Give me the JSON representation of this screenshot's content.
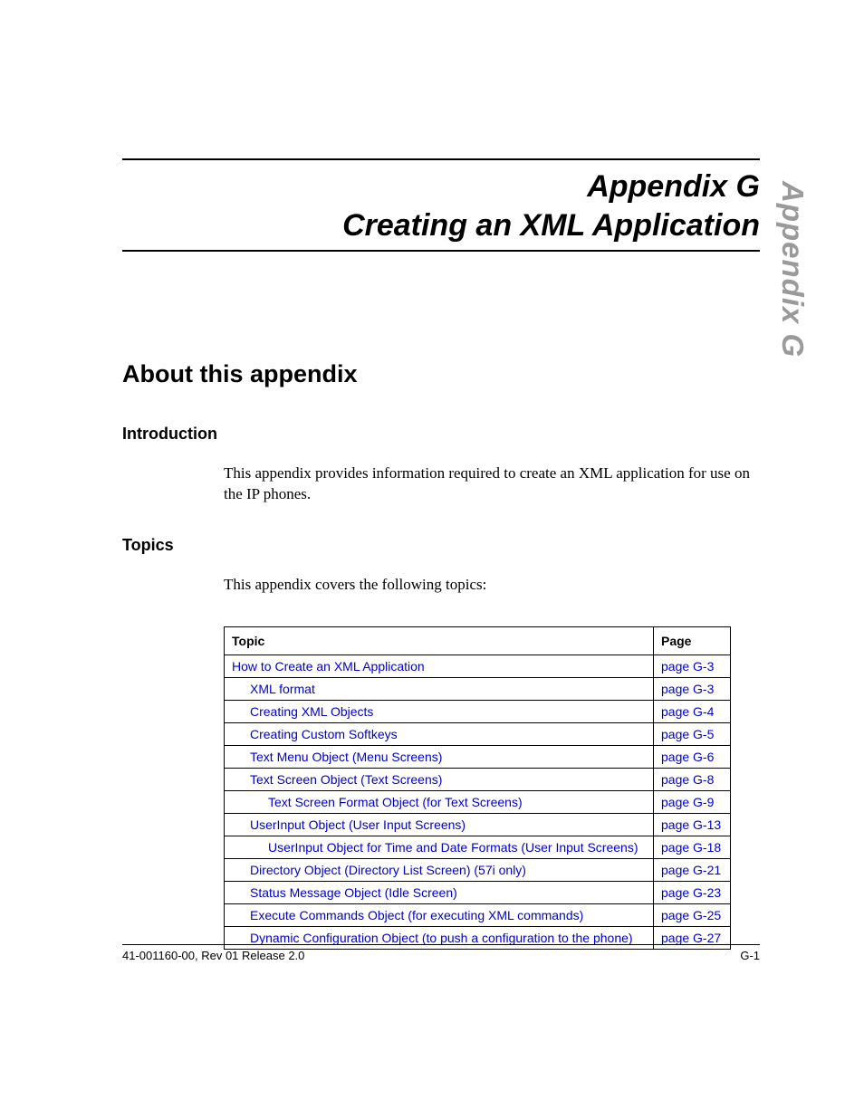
{
  "title": {
    "line1": "Appendix G",
    "line2": "Creating an XML Application"
  },
  "side_tab": "Appendix G",
  "sections": {
    "about": "About this appendix",
    "intro_heading": "Introduction",
    "intro_body": "This appendix provides information required to create an XML application for use on the IP phones.",
    "topics_heading": "Topics",
    "topics_body": "This appendix covers the following topics:"
  },
  "table": {
    "headers": {
      "topic": "Topic",
      "page": "Page"
    },
    "rows": [
      {
        "topic": "How to Create an XML Application",
        "page": "page G-3",
        "indent": 0
      },
      {
        "topic": "XML format",
        "page": "page G-3",
        "indent": 1
      },
      {
        "topic": "Creating XML Objects",
        "page": "page G-4",
        "indent": 1
      },
      {
        "topic": "Creating Custom Softkeys",
        "page": "page G-5",
        "indent": 1
      },
      {
        "topic": "Text Menu Object (Menu Screens)",
        "page": "page G-6",
        "indent": 1
      },
      {
        "topic": "Text Screen Object (Text Screens)",
        "page": "page G-8",
        "indent": 1
      },
      {
        "topic": "Text Screen Format Object (for Text Screens)",
        "page": "page G-9",
        "indent": 2
      },
      {
        "topic": "UserInput Object (User Input Screens)",
        "page": "page G-13",
        "indent": 1
      },
      {
        "topic": "UserInput Object for Time and Date Formats (User Input Screens)",
        "page": "page G-18",
        "indent": 2
      },
      {
        "topic": "Directory Object (Directory List Screen) (57i only)",
        "page": "page G-21",
        "indent": 1
      },
      {
        "topic": "Status Message Object (Idle Screen)",
        "page": "page G-23",
        "indent": 1
      },
      {
        "topic": "Execute Commands Object (for executing XML commands)",
        "page": "page G-25",
        "indent": 1
      },
      {
        "topic": "Dynamic Configuration Object (to push a configuration to the phone)",
        "page": "page G-27",
        "indent": 1
      }
    ]
  },
  "footer": {
    "left": "41-001160-00, Rev 01  Release 2.0",
    "right": "G-1"
  }
}
